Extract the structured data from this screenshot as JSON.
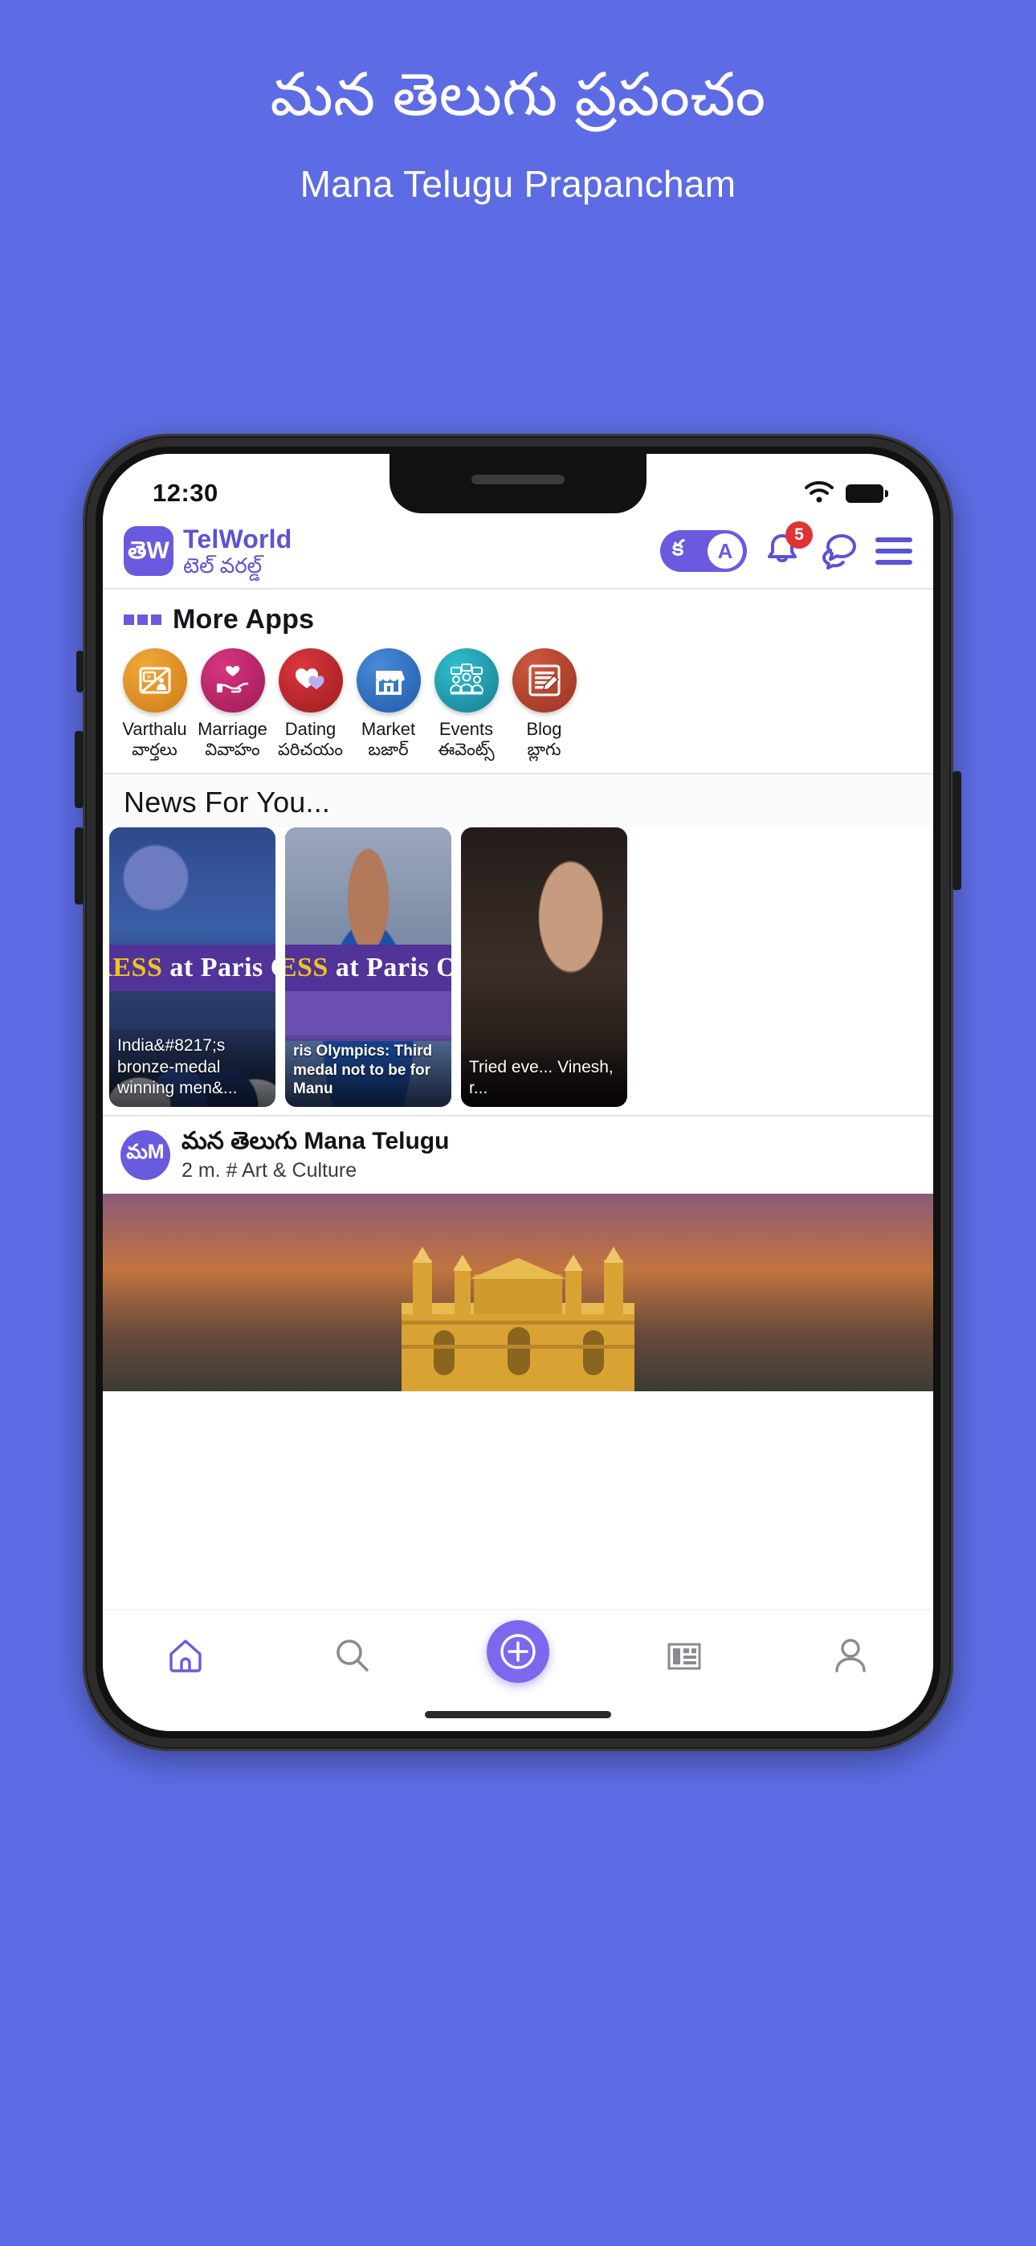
{
  "hero": {
    "title_te": "మన తెలుగు ప్రపంచం",
    "title_en": "Mana Telugu Prapancham"
  },
  "colors": {
    "background": "#5d6ce4",
    "brand_purple": "#6a5ae0",
    "badge_red": "#e03434",
    "accent_gold": "#f0c419"
  },
  "status_bar": {
    "time": "12:30",
    "wifi_icon": "wifi-icon",
    "battery_icon": "battery-icon"
  },
  "app_header": {
    "logo_text": "తెW",
    "brand_name": "TelWorld",
    "brand_sub": "టెల్ వరల్డ్",
    "language_toggle": {
      "telugu_label": "క",
      "english_label": "A",
      "active": "A"
    },
    "notifications": {
      "icon": "bell-icon",
      "badge_count": "5"
    },
    "chat_icon": "chat-bubbles-icon",
    "menu_icon": "hamburger-menu-icon"
  },
  "more_apps": {
    "title": "More Apps",
    "grid_icon": "grid-squares-icon",
    "items": [
      {
        "label_en": "Varthalu",
        "label_te": "వార్తలు",
        "icon": "news-tv-icon",
        "color": "#e8952a"
      },
      {
        "label_en": "Marriage",
        "label_te": "వివాహం",
        "icon": "hands-heart-icon",
        "color": "#c2256e"
      },
      {
        "label_en": "Dating",
        "label_te": "పరిచయం",
        "icon": "two-hearts-icon",
        "color": "#c3262c"
      },
      {
        "label_en": "Market",
        "label_te": "బజార్",
        "icon": "storefront-icon",
        "color": "#2f6fc4"
      },
      {
        "label_en": "Events",
        "label_te": "ఈవెంట్స్",
        "icon": "people-chat-icon",
        "color": "#1fa3b8"
      },
      {
        "label_en": "Blog",
        "label_te": "బ్లాగు",
        "icon": "write-document-icon",
        "color": "#b9432c"
      }
    ]
  },
  "news": {
    "heading": "News For You...",
    "cards": [
      {
        "banner_gold": "RESS",
        "banner_white": "at Paris O",
        "caption": "India&#8217;s bronze-medal winning men&...",
        "image": "hockey-team-celebration"
      },
      {
        "banner_gold": "ESS",
        "banner_white": "at Paris O",
        "caption": "ris Olympics: Third medal not to be for Manu",
        "image": "manu-bhaker-portrait"
      },
      {
        "banner_gold": "",
        "banner_white": "",
        "caption": "Tried eve... Vinesh, r...",
        "image": "dark-portrait"
      }
    ]
  },
  "post": {
    "avatar_text": "మM",
    "author_te": "మన తెలుగు",
    "author_en": "Mana Telugu",
    "meta": "2 m. # Art & Culture",
    "image": "charminar-hyderabad"
  },
  "bottom_nav": {
    "items": [
      {
        "name": "home",
        "icon": "home-icon",
        "active": true
      },
      {
        "name": "search",
        "icon": "search-icon",
        "active": false
      },
      {
        "name": "create",
        "icon": "plus-circle-icon",
        "active": false
      },
      {
        "name": "news",
        "icon": "news-grid-icon",
        "active": false
      },
      {
        "name": "profile",
        "icon": "person-icon",
        "active": false
      }
    ]
  }
}
